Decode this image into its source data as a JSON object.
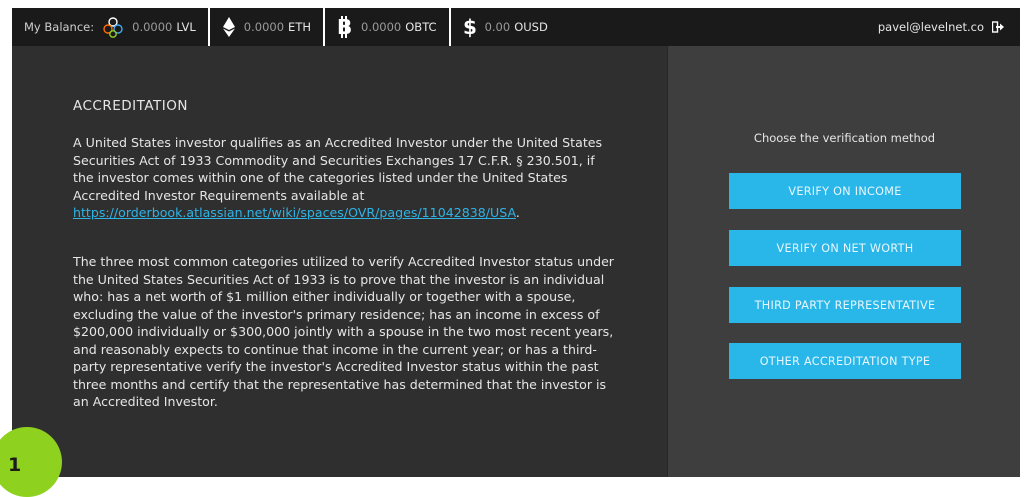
{
  "topbar": {
    "balance_label": "My Balance:",
    "currencies": [
      {
        "icon": "lvl-token-icon",
        "amount": "0.0000",
        "unit": "LVL"
      },
      {
        "icon": "ethereum-icon",
        "amount": "0.0000",
        "unit": "ETH"
      },
      {
        "icon": "bitcoin-icon",
        "amount": "0.0000",
        "unit": "OBTC"
      },
      {
        "icon": "dollar-icon",
        "amount": "0.00",
        "unit": "OUSD"
      }
    ],
    "user_email": "pavel@levelnet.co",
    "logout_icon": "logout-icon"
  },
  "content": {
    "title": "ACCREDITATION",
    "para1_text": "A United States investor qualifies as an Accredited Investor under the United States Securities Act of 1933 Commodity and Securities Exchanges 17 C.F.R. § 230.501, if the investor comes within one of the categories listed under the United States Accredited Investor Requirements available at ",
    "para1_link": "https://orderbook.atlassian.net/wiki/spaces/OVR/pages/11042838/USA",
    "para1_end": ".",
    "para2": "The three most common categories utilized to verify Accredited Investor status under the United States Securities Act of 1933 is to prove that the investor is an individual who: has a net worth of $1 million either individually or together with a spouse, excluding the value of the investor's primary residence; has an income in excess of $200,000 individually or $300,000 jointly with a spouse in the two most recent years, and reasonably expects to continue that income in the current year; or has a third-party representative verify the investor's Accredited Investor status within the past three months and certify that the representative has determined that the investor is an Accredited Investor."
  },
  "verification": {
    "prompt": "Choose the verification method",
    "buttons": [
      "VERIFY ON INCOME",
      "VERIFY ON NET WORTH",
      "THIRD PARTY REPRESENTATIVE",
      "OTHER ACCREDITATION TYPE"
    ]
  },
  "badge": "1",
  "colors": {
    "accent": "#29b6e8",
    "topbar_bg": "#1a1a1a",
    "panel_bg": "#2f2f2f",
    "side_panel_bg": "#3e3e3e",
    "badge": "#8fd11f"
  }
}
